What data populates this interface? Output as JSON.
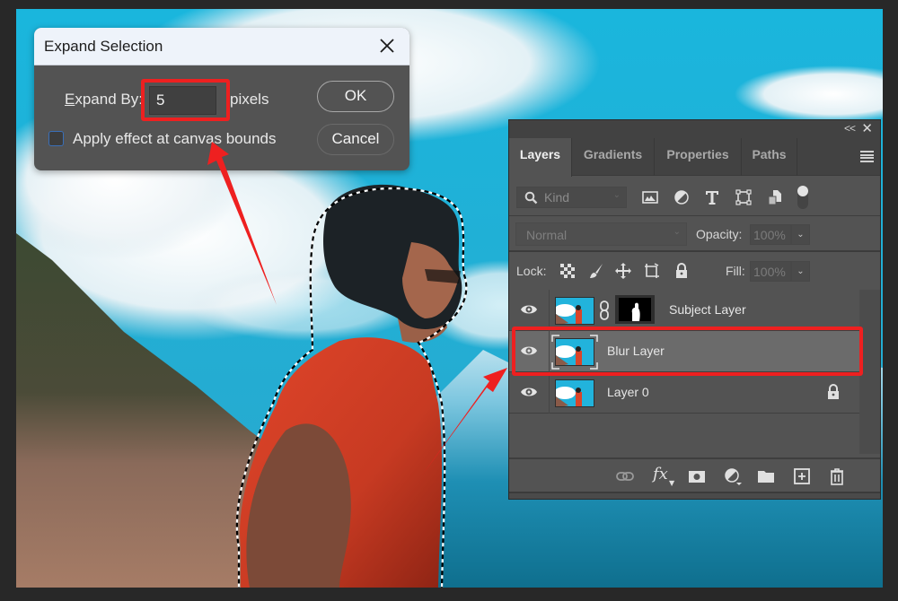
{
  "dialog": {
    "title": "Expand Selection",
    "expand_label_underlined": "E",
    "expand_label_rest": "xpand By:",
    "expand_value": "5",
    "units_label": "pixels",
    "checkbox_label": "Apply effect at canvas bounds",
    "checkbox_checked": false,
    "ok_label": "OK",
    "cancel_label": "Cancel"
  },
  "panel": {
    "collapse_label": "<<",
    "close_label": "✕",
    "tabs": [
      {
        "label": "Layers",
        "active": true
      },
      {
        "label": "Gradients",
        "active": false
      },
      {
        "label": "Properties",
        "active": false
      },
      {
        "label": "Paths",
        "active": false
      }
    ],
    "filter": {
      "placeholder": "Kind",
      "icons": [
        "pixel-layer-filter-icon",
        "adjustment-layer-filter-icon",
        "type-layer-filter-icon",
        "shape-layer-filter-icon",
        "smart-object-filter-icon",
        "filter-toggle-icon"
      ]
    },
    "blend_mode": "Normal",
    "opacity_label": "Opacity:",
    "opacity_value": "100%",
    "lock_label": "Lock:",
    "lock_icons": [
      "lock-transparent-pixels-icon",
      "lock-image-pixels-icon",
      "lock-position-icon",
      "lock-artboard-icon",
      "lock-all-icon"
    ],
    "fill_label": "Fill:",
    "fill_value": "100%",
    "layers": [
      {
        "name": "Subject Layer",
        "visible": true,
        "has_mask": true,
        "selected": false,
        "locked": false
      },
      {
        "name": "Blur Layer",
        "visible": true,
        "has_mask": false,
        "selected": true,
        "locked": false
      },
      {
        "name": "Layer 0",
        "visible": true,
        "has_mask": false,
        "selected": false,
        "locked": true
      }
    ],
    "bottom_icons": [
      "link-layers-icon",
      "layer-style-fx-icon",
      "add-mask-icon",
      "adjustment-layer-icon",
      "new-group-folder-icon",
      "new-layer-icon",
      "delete-layer-icon"
    ],
    "fx_label": "fx"
  },
  "annotations": {
    "highlight_color": "#ee2020",
    "arrows": [
      "arrow-to-expand-input",
      "arrow-to-blur-layer"
    ]
  }
}
